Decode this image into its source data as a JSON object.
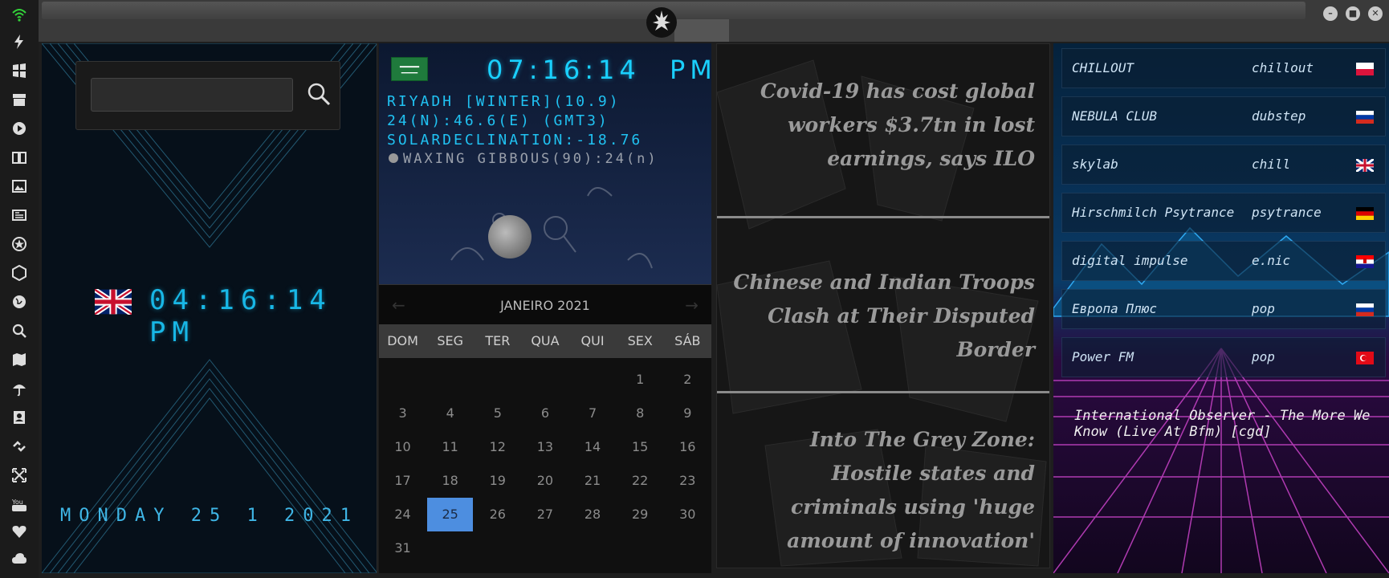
{
  "top_bar": {
    "window_buttons": [
      "–",
      "■",
      "✕"
    ]
  },
  "sidebar": {
    "icons": [
      "wifi-icon",
      "bolt-icon",
      "windows-icon",
      "archive-icon",
      "play-icon",
      "book-icon",
      "image-icon",
      "news-icon",
      "star-badge-icon",
      "hexagon-icon",
      "globe-icon",
      "search-icon",
      "map-icon",
      "umbrella-icon",
      "contacts-icon",
      "link-icon",
      "expand-icon",
      "youtube-icon",
      "heart-icon",
      "cloud-icon"
    ]
  },
  "clock_panel": {
    "time": "04:16:14",
    "ampm": "PM",
    "date": "MONDAY 25 1 2021"
  },
  "world_clock": {
    "time": "07:16:14",
    "ampm": "PM",
    "location": "RIYADH [WINTER](10.9)",
    "coordinates": "24(N):46.6(E) (GMT3)",
    "solar": "SOLARDECLINATION:-18.76",
    "moon": "WAXING GIBBOUS(90):24",
    "moon_suffix": "(n)"
  },
  "calendar": {
    "month": "JANEIRO 2021",
    "prev": "←",
    "next": "→",
    "weekdays": [
      "DOM",
      "SEG",
      "TER",
      "QUA",
      "QUI",
      "SEX",
      "SÁB"
    ],
    "leading_blanks": 5,
    "days": [
      "1",
      "2",
      "3",
      "4",
      "5",
      "6",
      "7",
      "8",
      "9",
      "10",
      "11",
      "12",
      "13",
      "14",
      "15",
      "16",
      "17",
      "18",
      "19",
      "20",
      "21",
      "22",
      "23",
      "24",
      "25",
      "26",
      "27",
      "28",
      "29",
      "30",
      "31"
    ],
    "today": "25"
  },
  "news": {
    "items": [
      "Covid-19 has cost global workers $3.7tn in lost earnings, says ILO",
      "Chinese and Indian Troops Clash at Their Disputed Border",
      "Into The Grey Zone: Hostile states and criminals using 'huge amount of innovation'"
    ]
  },
  "radio": {
    "stations": [
      {
        "name": "CHILLOUT",
        "genre": "chillout",
        "flag": "poland"
      },
      {
        "name": "NEBULA CLUB",
        "genre": "dubstep",
        "flag": "russia"
      },
      {
        "name": "skylab",
        "genre": "chill",
        "flag": "uk"
      },
      {
        "name": "Hirschmilch Psytrance",
        "genre": "psytrance",
        "flag": "germany"
      },
      {
        "name": "digital impulse",
        "genre": "e.nic",
        "flag": "croatia"
      },
      {
        "name": "Европа Плюс",
        "genre": "pop",
        "flag": "russia"
      },
      {
        "name": "Power FM",
        "genre": "pop",
        "flag": "turkey"
      }
    ],
    "now_playing": "International Observer - The More We Know (Live At Bfm) [cgd]"
  }
}
